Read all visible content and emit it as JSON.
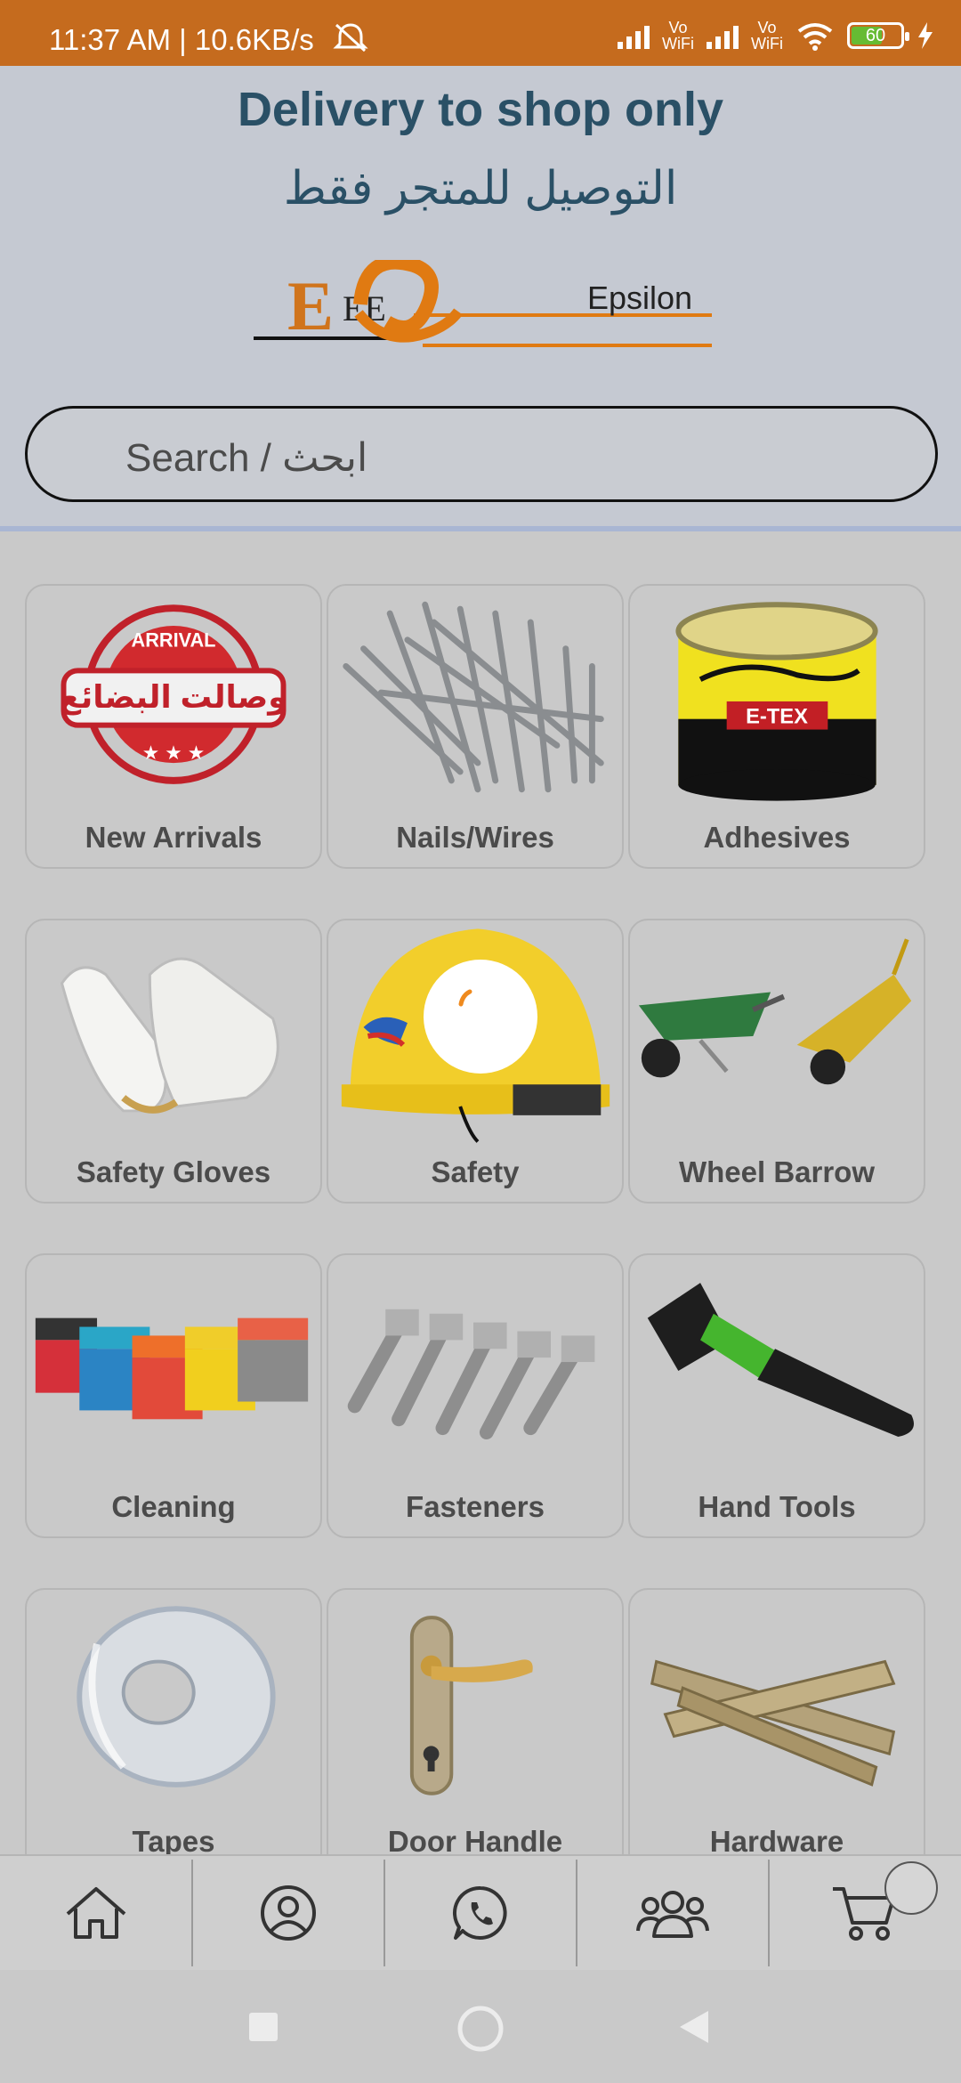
{
  "status_bar": {
    "time": "11:37 AM | 10.6KB/s",
    "vowifi_1": "Vo\nWiFi",
    "vowifi_2": "Vo\nWiFi",
    "battery": "60"
  },
  "header": {
    "delivery_en": "Delivery to shop only",
    "delivery_ar": "التوصيل للمتجر فقط",
    "logo_text": "Epsilon",
    "logo_letters": "EE"
  },
  "search": {
    "placeholder": "Search / ابحث"
  },
  "categories": [
    {
      "label": "New Arrivals",
      "badge_ar": "وصالت البضائع",
      "badge_en": "ARRIVAL"
    },
    {
      "label": "Nails/Wires"
    },
    {
      "label": "Adhesives",
      "brand": "E-TEX"
    },
    {
      "label": "Safety Gloves"
    },
    {
      "label": "Safety"
    },
    {
      "label": "Wheel Barrow"
    },
    {
      "label": "Cleaning"
    },
    {
      "label": "Fasteners"
    },
    {
      "label": "Hand Tools"
    },
    {
      "label": "Tapes"
    },
    {
      "label": "Door Handle"
    },
    {
      "label": "Hardware"
    }
  ],
  "bottom_nav": [
    {
      "icon": "home-icon"
    },
    {
      "icon": "profile-icon"
    },
    {
      "icon": "whatsapp-icon"
    },
    {
      "icon": "group-icon"
    },
    {
      "icon": "cart-icon"
    }
  ],
  "colors": {
    "status_bar": "#c56b1e",
    "header_bg": "#c5c9d2",
    "title_text": "#2a5066",
    "logo_orange": "#e07a12"
  }
}
